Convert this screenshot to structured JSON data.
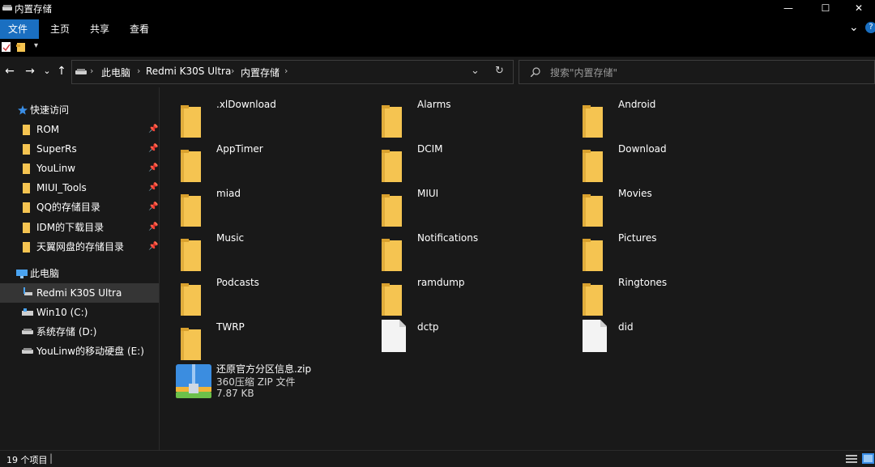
{
  "window": {
    "title": "内置存储",
    "minimize_symbol": "—",
    "maximize_symbol": "☐",
    "close_symbol": "✕"
  },
  "ribbon": {
    "tabs": [
      {
        "label": "文件",
        "active": true
      },
      {
        "label": "主页",
        "active": false
      },
      {
        "label": "共享",
        "active": false
      },
      {
        "label": "查看",
        "active": false
      }
    ],
    "expand_symbol": "⌄",
    "help_symbol": "?"
  },
  "nav": {
    "back": "←",
    "forward": "→",
    "recent": "⌄",
    "up": "↑",
    "refresh": "↻",
    "dropdown": "⌄"
  },
  "breadcrumb": [
    "此电脑",
    "Redmi K30S Ultra",
    "内置存储"
  ],
  "search": {
    "placeholder": "搜索\"内置存储\""
  },
  "sidebar": {
    "quick_access_label": "快速访问",
    "quick_access": [
      {
        "label": "ROM",
        "pinned": true
      },
      {
        "label": "SuperRs",
        "pinned": true
      },
      {
        "label": "YouLinw",
        "pinned": true
      },
      {
        "label": "MIUI_Tools",
        "pinned": true
      },
      {
        "label": "QQ的存储目录",
        "pinned": true
      },
      {
        "label": "IDM的下载目录",
        "pinned": true
      },
      {
        "label": "天翼网盘的存储目录",
        "pinned": true
      }
    ],
    "this_pc_label": "此电脑",
    "devices": [
      {
        "label": "Redmi K30S Ultra",
        "selected": true,
        "icon": "phone-icon"
      },
      {
        "label": "Win10 (C:)",
        "selected": false,
        "icon": "windows-drive-icon"
      },
      {
        "label": "系统存储 (D:)",
        "selected": false,
        "icon": "drive-icon"
      },
      {
        "label": "YouLinw的移动硬盘 (E:)",
        "selected": false,
        "icon": "drive-icon"
      }
    ]
  },
  "items": [
    {
      "name": ".xlDownload",
      "type": "folder"
    },
    {
      "name": "Alarms",
      "type": "folder"
    },
    {
      "name": "Android",
      "type": "folder"
    },
    {
      "name": "AppTimer",
      "type": "folder"
    },
    {
      "name": "DCIM",
      "type": "folder"
    },
    {
      "name": "Download",
      "type": "folder"
    },
    {
      "name": "miad",
      "type": "folder"
    },
    {
      "name": "MIUI",
      "type": "folder"
    },
    {
      "name": "Movies",
      "type": "folder"
    },
    {
      "name": "Music",
      "type": "folder"
    },
    {
      "name": "Notifications",
      "type": "folder"
    },
    {
      "name": "Pictures",
      "type": "folder"
    },
    {
      "name": "Podcasts",
      "type": "folder"
    },
    {
      "name": "ramdump",
      "type": "folder"
    },
    {
      "name": "Ringtones",
      "type": "folder"
    },
    {
      "name": "TWRP",
      "type": "folder"
    },
    {
      "name": "dctp",
      "type": "file"
    },
    {
      "name": "did",
      "type": "file"
    }
  ],
  "zip_file": {
    "name": "还原官方分区信息.zip",
    "type_label": "360压缩 ZIP 文件",
    "size": "7.87 KB"
  },
  "status": {
    "item_count": "19 个项目"
  },
  "colors": {
    "accent": "#1a6fc1",
    "folder": "#f5c451",
    "background": "#191919"
  }
}
